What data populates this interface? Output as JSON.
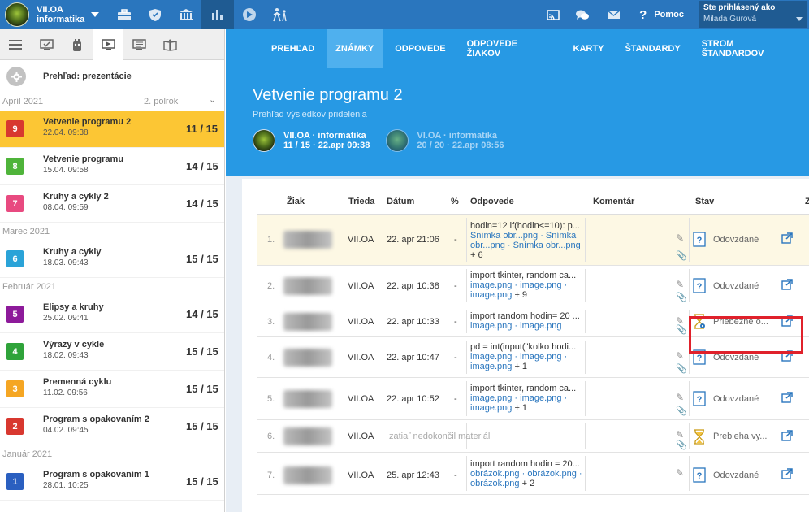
{
  "topbar": {
    "class_name_line1": "VII.OA",
    "class_name_line2": "informatika",
    "help_label": "Pomoc",
    "logged_in_label": "Ste prihlásený ako",
    "user_name": "Milada Gurová"
  },
  "sidebar": {
    "title": "Prehľad: prezentácie",
    "period": "2. polrok",
    "months": {
      "april": "Apríl 2021",
      "march": "Marec 2021",
      "february": "Február 2021",
      "january": "Január 2021"
    },
    "items": [
      {
        "num": "9",
        "name": "Vetvenie programu 2",
        "date": "22.04. 09:38",
        "score": "11 / 15",
        "color": "#d8382f"
      },
      {
        "num": "8",
        "name": "Vetvenie programu",
        "date": "15.04. 09:58",
        "score": "14 / 15",
        "color": "#4fb43a"
      },
      {
        "num": "7",
        "name": "Kruhy a cykly 2",
        "date": "08.04. 09:59",
        "score": "14 / 15",
        "color": "#e84a80"
      },
      {
        "num": "6",
        "name": "Kruhy a cykly",
        "date": "18.03. 09:43",
        "score": "15 / 15",
        "color": "#2aa3d8"
      },
      {
        "num": "5",
        "name": "Elipsy a kruhy",
        "date": "25.02. 09:41",
        "score": "14 / 15",
        "color": "#8d1a9a"
      },
      {
        "num": "4",
        "name": "Výrazy v cykle",
        "date": "18.02. 09:43",
        "score": "15 / 15",
        "color": "#2fa33a"
      },
      {
        "num": "3",
        "name": "Premenná cyklu",
        "date": "11.02. 09:56",
        "score": "15 / 15",
        "color": "#f5a623"
      },
      {
        "num": "2",
        "name": "Program s opakovaním 2",
        "date": "04.02. 09:45",
        "score": "15 / 15",
        "color": "#d8382f"
      },
      {
        "num": "1",
        "name": "Program s opakovaním 1",
        "date": "28.01. 10:25",
        "score": "15 / 15",
        "color": "#2a5fc0"
      }
    ]
  },
  "nav": {
    "tabs": [
      "PREHĽAD",
      "ZNÁMKY",
      "ODPOVEDE",
      "ODPOVEDE ŽIAKOV",
      "KARTY",
      "ŠTANDARDY",
      "STROM ŠTANDARDOV"
    ],
    "active_index": 1
  },
  "header": {
    "title": "Vetvenie programu 2",
    "subtitle": "Prehľad výsledkov pridelenia",
    "group1_name": "VII.OA · informatika",
    "group1_stats": "11 / 15 · 22.apr 09:38",
    "group2_name": "VI.OA · informatika",
    "group2_stats": "20 / 20 · 22.apr 08:56"
  },
  "table": {
    "headers": {
      "student": "Žiak",
      "class": "Trieda",
      "date": "Dátum",
      "percent": "%",
      "answers": "Odpovede",
      "comment": "Komentár",
      "status": "Stav",
      "extra": "Z"
    },
    "rows": [
      {
        "num": "1.",
        "class": "VII.OA",
        "date": "22. apr 21:06",
        "pct": "-",
        "code": "hodin=12 if(hodin<=10): p...",
        "files": "Snímka obr...png · Snímka obr...png · Snímka obr...png",
        "more": "+ 6",
        "status": "Odovzdané",
        "status_type": "submitted",
        "highlight": true
      },
      {
        "num": "2.",
        "class": "VII.OA",
        "date": "22. apr 10:38",
        "pct": "-",
        "code": "import tkinter, random ca...",
        "files": "image.png · image.png · image.png",
        "more": "+ 9",
        "status": "Odovzdané",
        "status_type": "submitted"
      },
      {
        "num": "3.",
        "class": "VII.OA",
        "date": "22. apr 10:33",
        "pct": "-",
        "code": "import random hodin= 20 ...",
        "files": "image.png · image.png",
        "more": "",
        "status": "Priebežné o...",
        "status_type": "progress"
      },
      {
        "num": "4.",
        "class": "VII.OA",
        "date": "22. apr 10:47",
        "pct": "-",
        "code": "pd = int(input(\"kolko hodi...",
        "files": "image.png · image.png · image.png",
        "more": "+ 1",
        "status": "Odovzdané",
        "status_type": "submitted"
      },
      {
        "num": "5.",
        "class": "VII.OA",
        "date": "22. apr 10:52",
        "pct": "-",
        "code": "import tkinter, random ca...",
        "files": "image.png · image.png · image.png",
        "more": "+ 1",
        "status": "Odovzdané",
        "status_type": "submitted"
      },
      {
        "num": "6.",
        "class": "VII.OA",
        "date": "",
        "pct": "",
        "note": "zatiaľ nedokončil materiál",
        "status": "Prebieha vy...",
        "status_type": "running"
      },
      {
        "num": "7.",
        "class": "VII.OA",
        "date": "25. apr 12:43",
        "pct": "-",
        "code": "import random hodin = 20...",
        "files": "obrázok.png · obrázok.png · obrázok.png",
        "more": "+ 2",
        "status": "Odovzdané",
        "status_type": "submitted"
      }
    ]
  }
}
